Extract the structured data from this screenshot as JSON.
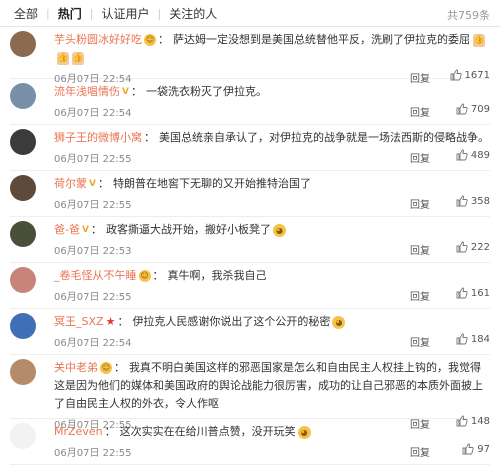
{
  "tabs": [
    {
      "label": "全部"
    },
    {
      "label": "热门"
    },
    {
      "label": "认证用户"
    },
    {
      "label": "关注的人"
    }
  ],
  "total": "共759条",
  "reply_label": "回复",
  "comments": [
    {
      "user": "芋头粉圆冰好好吃",
      "badge": "smile",
      "text": "萨达姆一定没想到是美国总统替他平反，洗刷了伊拉克的委屈",
      "time": "06月07日 22:54",
      "likes": "1671",
      "avatar_color": "#8b6a4f",
      "trail": "thumbs"
    },
    {
      "user": "流年浅唱情伤",
      "badge": "vip",
      "text": "一袋洗衣粉灭了伊拉克。",
      "time": "06月07日 22:54",
      "likes": "709",
      "avatar_color": "#7a8fa8",
      "trail": ""
    },
    {
      "user": "狮子王的微博小窝",
      "badge": "",
      "text": "美国总统亲自承认了，对伊拉克的战争就是一场法西斯的侵略战争。",
      "time": "06月07日 22:55",
      "likes": "489",
      "avatar_color": "#3b3b3b",
      "trail": ""
    },
    {
      "user": "荷尔蒙",
      "badge": "vip",
      "text": "特朗普在地窖下无聊的又开始推特治国了",
      "time": "06月07日 22:55",
      "likes": "358",
      "avatar_color": "#5d4a3c",
      "trail": ""
    },
    {
      "user": "爸-爸",
      "badge": "vip",
      "text": "政客撕逼大战开始，搬好小板凳了",
      "time": "06月07日 22:53",
      "likes": "222",
      "avatar_color": "#4a4f3a",
      "trail": "emoji"
    },
    {
      "user": "_卷毛怪从不午睡",
      "badge": "smile",
      "text": "真牛啊，我杀我自己",
      "time": "06月07日 22:55",
      "likes": "161",
      "avatar_color": "#c9847a",
      "trail": ""
    },
    {
      "user": "冥王_SXZ",
      "badge": "star",
      "text": "伊拉克人民感谢你说出了这个公开的秘密",
      "time": "06月07日 22:54",
      "likes": "184",
      "avatar_color": "#3f6fb5",
      "trail": "emoji"
    },
    {
      "user": "关中老弟",
      "badge": "smile",
      "text": "我真不明白美国这样的邪恶国家是怎么和自由民主人权挂上钩的，我觉得这是因为他们的媒体和美国政府的舆论战能力很厉害，成功的让自己邪恶的本质外面披上了自由民主人权的外衣，令人作呕",
      "time": "06月07日 22:55",
      "likes": "148",
      "avatar_color": "#b58c6a",
      "trail": ""
    },
    {
      "user": "MrZeven",
      "badge": "",
      "text": "这次实实在在给川普点赞，没开玩笑",
      "time": "06月07日 22:55",
      "likes": "97",
      "avatar_color": "#f2f2f2",
      "trail": "emoji"
    }
  ]
}
